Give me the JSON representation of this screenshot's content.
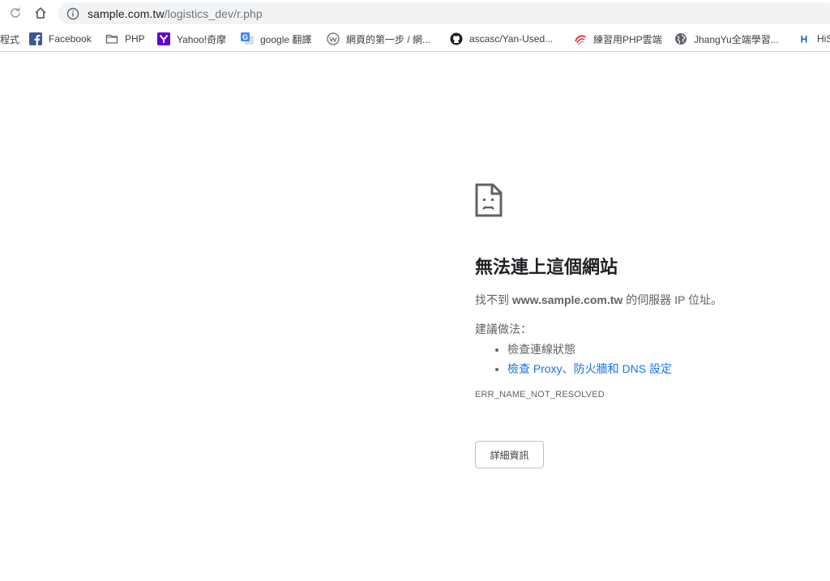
{
  "browser": {
    "url_host": "sample.com.tw",
    "url_path": "/logistics_dev/r.php",
    "icons": {
      "reload": "reload-icon",
      "home": "home-icon",
      "site_info": "info-icon"
    }
  },
  "bookmarks": [
    {
      "label": "程式",
      "icon": "none"
    },
    {
      "label": "Facebook",
      "icon": "facebook-icon"
    },
    {
      "label": "PHP",
      "icon": "folder-icon"
    },
    {
      "label": "Yahoo!奇摩",
      "icon": "yahoo-icon"
    },
    {
      "label": "google 翻譯",
      "icon": "google-translate-icon"
    },
    {
      "label": "網頁的第一步 / 網...",
      "icon": "w-icon"
    },
    {
      "label": "ascasc/Yan-Used...",
      "icon": "github-icon"
    },
    {
      "label": "練習用PHP雲端",
      "icon": "swirl-icon"
    },
    {
      "label": "JhangYu全端學習...",
      "icon": "globe-icon"
    },
    {
      "label": "HiS",
      "icon": "h-icon"
    }
  ],
  "error_page": {
    "icon": "sad-page-icon",
    "title": "無法連上這個網站",
    "desc_prefix": "找不到 ",
    "desc_host": "www.sample.com.tw",
    "desc_suffix": " 的伺服器 IP 位址。",
    "try_label": "建議做法：",
    "suggestions": [
      {
        "label": "檢查連線狀態",
        "is_link": false
      },
      {
        "label": "檢查 Proxy、防火牆和 DNS 設定",
        "is_link": true
      }
    ],
    "error_code": "ERR_NAME_NOT_RESOLVED",
    "details_button": "詳細資訊"
  },
  "colors": {
    "link": "#1a73e8",
    "text": "#202124",
    "secondary": "#5f6368",
    "omnibox_bg": "#f1f3f4"
  }
}
